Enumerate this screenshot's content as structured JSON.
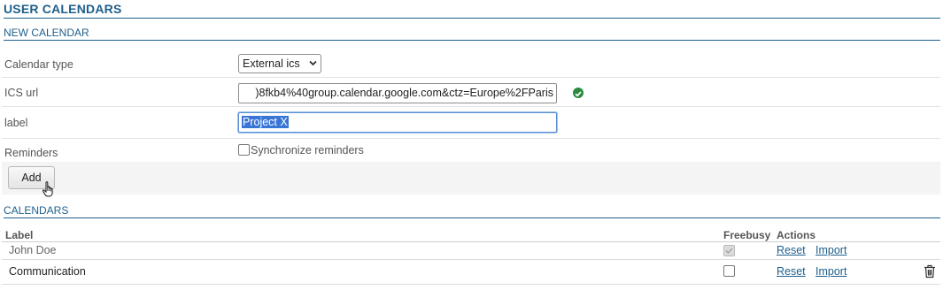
{
  "page": {
    "title": "USER CALENDARS"
  },
  "new_calendar": {
    "section_title": "NEW CALENDAR",
    "fields": {
      "type": {
        "label": "Calendar type",
        "value": "External ics"
      },
      "url": {
        "label": "ICS url",
        "value": ")8fkb4%40group.calendar.google.com&ctz=Europe%2FParis",
        "status_icon": "check-circle-icon"
      },
      "label": {
        "label": "label",
        "value": "Project X"
      },
      "reminders": {
        "label": "Reminders",
        "option_label": "Synchronize reminders",
        "checked": false
      }
    },
    "add_label": "Add"
  },
  "calendars": {
    "section_title": "CALENDARS",
    "headers": {
      "label": "Label",
      "freebusy": "Freebusy",
      "actions": "Actions"
    },
    "rows": [
      {
        "label": "John Doe",
        "freebusy": true,
        "freebusy_disabled": true,
        "reset": "Reset",
        "import": "Import",
        "deletable": false
      },
      {
        "label": "Communication",
        "freebusy": false,
        "freebusy_disabled": false,
        "reset": "Reset",
        "import": "Import",
        "deletable": true
      }
    ]
  },
  "colors": {
    "accent": "#1e5f8c",
    "success": "#2b8a3e",
    "selection": "#3875d7"
  }
}
